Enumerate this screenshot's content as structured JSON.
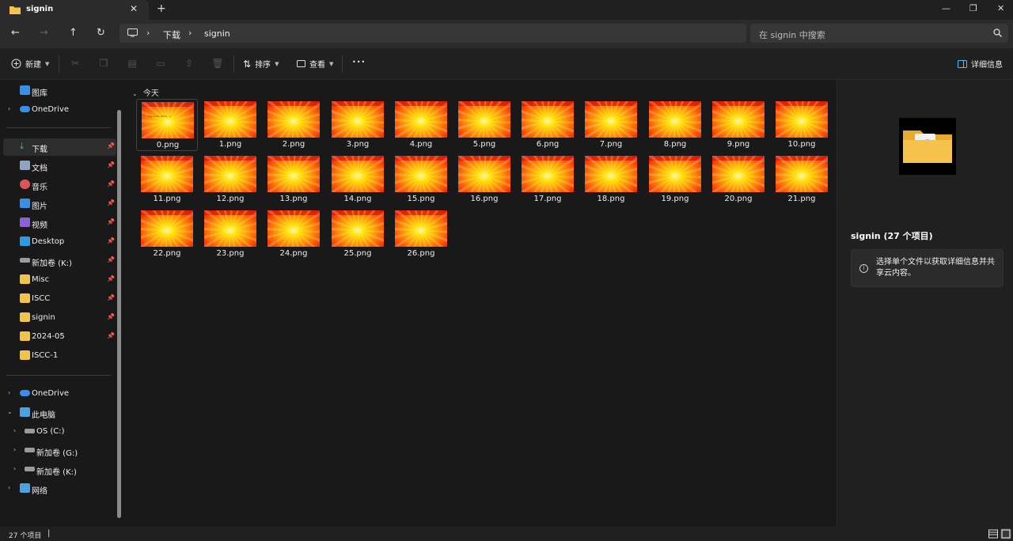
{
  "tab": {
    "title": "signin",
    "close": "✕",
    "new_tab": "+"
  },
  "window": {
    "minimize": "—",
    "maximize": "❐",
    "close": "✕"
  },
  "nav": {
    "back": "←",
    "forward": "→",
    "up": "↑",
    "refresh": "↻"
  },
  "breadcrumb": {
    "sep": "›",
    "items": [
      "下载",
      "signin"
    ]
  },
  "search": {
    "placeholder": "在 signin 中搜索"
  },
  "toolbar": {
    "new_label": "新建",
    "sort_label": "排序",
    "view_label": "查看",
    "more_label": "•••",
    "details_label": "详细信息"
  },
  "sidebar": {
    "top": [
      {
        "label": "图库",
        "icon": "gallery-icon"
      },
      {
        "label": "OneDrive",
        "icon": "cloud-icon"
      }
    ],
    "quick": [
      {
        "label": "下载",
        "icon": "download-icon"
      },
      {
        "label": "文档",
        "icon": "document-icon"
      },
      {
        "label": "音乐",
        "icon": "music-icon"
      },
      {
        "label": "图片",
        "icon": "picture-icon"
      },
      {
        "label": "视频",
        "icon": "video-icon"
      },
      {
        "label": "Desktop",
        "icon": "desktop-icon"
      },
      {
        "label": "新加卷 (K:)",
        "icon": "drive-icon"
      },
      {
        "label": "Misc",
        "icon": "folder-icon"
      },
      {
        "label": "ISCC",
        "icon": "folder-icon"
      },
      {
        "label": "signin",
        "icon": "folder-icon"
      },
      {
        "label": "2024-05",
        "icon": "folder-icon"
      },
      {
        "label": "ISCC-1",
        "icon": "folder-icon"
      }
    ],
    "bottom": [
      {
        "label": "OneDrive",
        "icon": "cloud-icon"
      },
      {
        "label": "此电脑",
        "icon": "pc-icon"
      },
      {
        "label": "OS (C:)",
        "icon": "drive-icon"
      },
      {
        "label": "新加卷 (G:)",
        "icon": "drive-icon"
      },
      {
        "label": "新加卷 (K:)",
        "icon": "drive-icon"
      },
      {
        "label": "网络",
        "icon": "network-icon"
      }
    ]
  },
  "content": {
    "group_label": "今天",
    "files": [
      "0.png",
      "1.png",
      "2.png",
      "3.png",
      "4.png",
      "5.png",
      "6.png",
      "7.png",
      "8.png",
      "9.png",
      "10.png",
      "11.png",
      "12.png",
      "13.png",
      "14.png",
      "15.png",
      "16.png",
      "17.png",
      "18.png",
      "19.png",
      "20.png",
      "21.png",
      "22.png",
      "23.png",
      "24.png",
      "25.png",
      "26.png"
    ],
    "thumb0_text": "flag is the ISCC{...}"
  },
  "details": {
    "title": "signin (27 个项目)",
    "info": "选择单个文件以获取详细信息并共享云内容。",
    "info_icon": "i"
  },
  "status": {
    "count": "27 个项目",
    "cursor": "|"
  },
  "colors": {
    "folder": "#f5c34b",
    "accent": "#4cc2ff",
    "bg": "#191919"
  }
}
